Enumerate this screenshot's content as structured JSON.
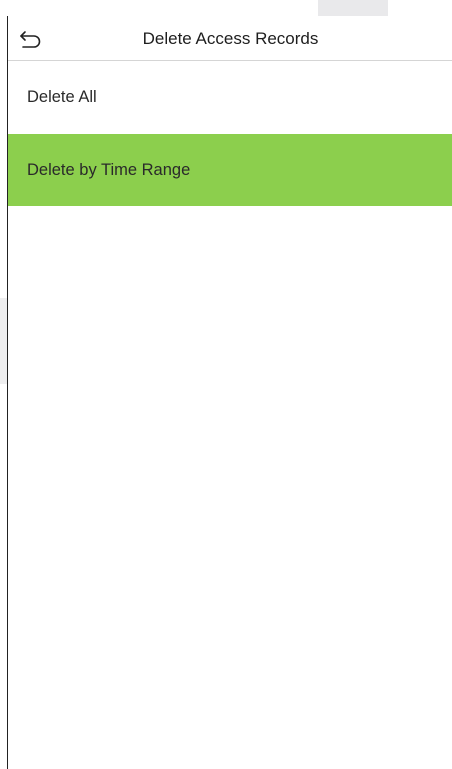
{
  "header": {
    "title": "Delete Access Records"
  },
  "menu": {
    "items": [
      {
        "label": "Delete All",
        "selected": false
      },
      {
        "label": "Delete by Time Range",
        "selected": true
      }
    ]
  },
  "colors": {
    "selected_item_background": "#8ccf4d",
    "divider": "#d5d5d5",
    "text": "#2a2a2a"
  },
  "icons": {
    "back": "back-arrow-icon"
  }
}
